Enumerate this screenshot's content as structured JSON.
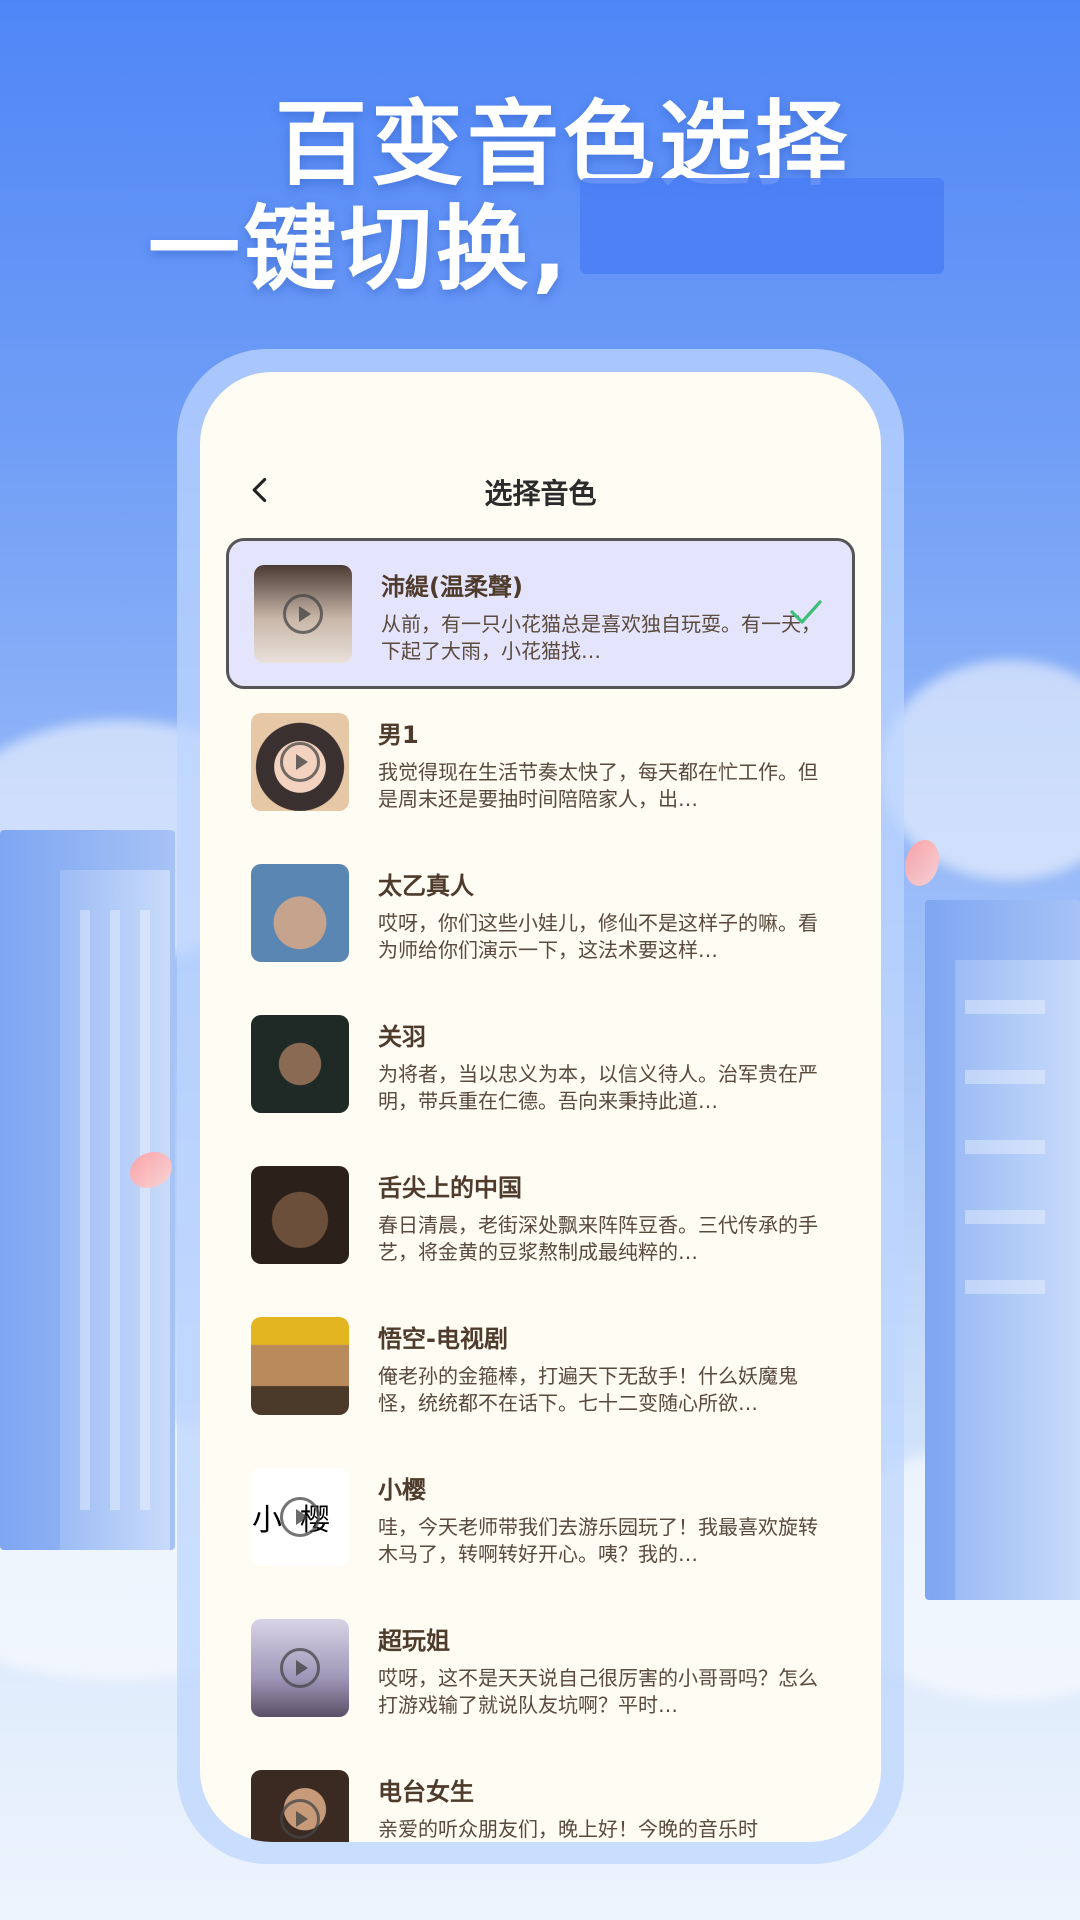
{
  "headline": {
    "line1": "百变音色选择",
    "line2": "一键切换,"
  },
  "page": {
    "title": "选择音色",
    "back_icon": "chevron-left-icon"
  },
  "colors": {
    "accent_check": "#3dbf7a",
    "selected_bg": "#e4e4fc",
    "card_bg": "#fffcf4"
  },
  "voices": [
    {
      "name": "沛緹(温柔聲)",
      "desc": "从前，有一只小花猫总是喜欢独自玩耍。有一天，下起了大雨，小花猫找…",
      "selected": true,
      "avatar_text": ""
    },
    {
      "name": "男1",
      "desc": "我觉得现在生活节奏太快了，每天都在忙工作。但是周末还是要抽时间陪陪家人，出…",
      "selected": false,
      "avatar_text": ""
    },
    {
      "name": "太乙真人",
      "desc": "哎呀，你们这些小娃儿，修仙不是这样子的嘛。看为师给你们演示一下，这法术要这样…",
      "selected": false,
      "avatar_text": ""
    },
    {
      "name": "关羽",
      "desc": "为将者，当以忠义为本，以信义待人。治军贵在严明，带兵重在仁德。吾向来秉持此道…",
      "selected": false,
      "avatar_text": ""
    },
    {
      "name": "舌尖上的中国",
      "desc": "春日清晨，老街深处飘来阵阵豆香。三代传承的手艺，将金黄的豆浆熬制成最纯粹的…",
      "selected": false,
      "avatar_text": ""
    },
    {
      "name": "悟空-电视剧",
      "desc": "俺老孙的金箍棒，打遍天下无敌手！什么妖魔鬼怪，统统都不在话下。七十二变随心所欲…",
      "selected": false,
      "avatar_text": ""
    },
    {
      "name": "小樱",
      "desc": "哇，今天老师带我们去游乐园玩了！我最喜欢旋转木马了，转啊转好开心。咦？我的…",
      "selected": false,
      "avatar_text": "小樱"
    },
    {
      "name": "超玩姐",
      "desc": "哎呀，这不是天天说自己很厉害的小哥哥吗？怎么打游戏输了就说队友坑啊？平时…",
      "selected": false,
      "avatar_text": ""
    },
    {
      "name": "电台女生",
      "desc": "亲爱的听众朋友们，晚上好！今晚的音乐时",
      "selected": false,
      "avatar_text": ""
    }
  ]
}
